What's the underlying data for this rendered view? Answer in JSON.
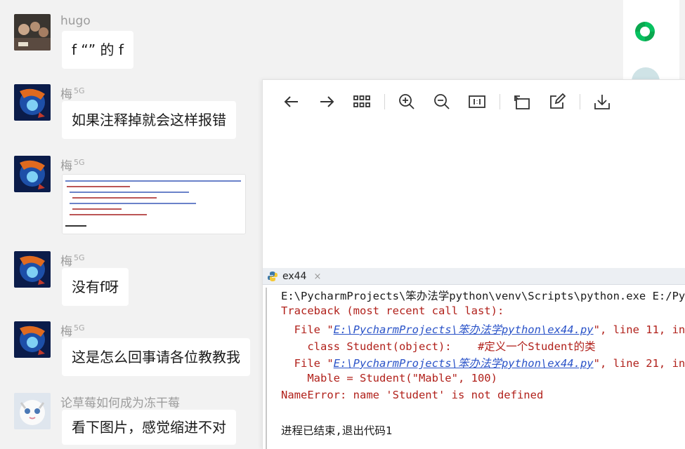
{
  "chat": {
    "messages": [
      {
        "sender": "hugo",
        "badge": "",
        "text": "f “” 的 f"
      },
      {
        "sender": "梅",
        "badge": "5G",
        "text": "如果注释掉就会这样报错"
      },
      {
        "sender": "梅",
        "badge": "5G",
        "text": ""
      },
      {
        "sender": "梅",
        "badge": "5G",
        "text": "没有f呀"
      },
      {
        "sender": "梅",
        "badge": "5G",
        "text": "这是怎么回事请各位教教我"
      },
      {
        "sender": "论草莓如何成为冻干莓",
        "badge": "",
        "text": "看下图片，感觉缩进不对"
      }
    ]
  },
  "viewer": {
    "tab_label": "ex44",
    "tab_close": "×",
    "console_lines": {
      "l1": "E:\\PycharmProjects\\笨办法学python\\venv\\Scripts\\python.exe E:/Pyc",
      "l2": "Traceback (most recent call last):",
      "l3a": "  File \"",
      "l3link": "E:\\PycharmProjects\\笨办法学python\\ex44.py",
      "l3b": "\", line 11, in",
      "l4": "    class Student(object):    #定义一个Student的类",
      "l5a": "  File \"",
      "l5link": "E:\\PycharmProjects\\笨办法学python\\ex44.py",
      "l5b": "\", line 21, in",
      "l6": "    Mable = Student(\"Mable\", 100)",
      "l7": "NameError: name 'Student' is not defined",
      "l8": "进程已结束,退出代码1"
    }
  },
  "colors": {
    "accent": "#07c160",
    "error": "#b1211b",
    "link": "#2a53c8"
  }
}
